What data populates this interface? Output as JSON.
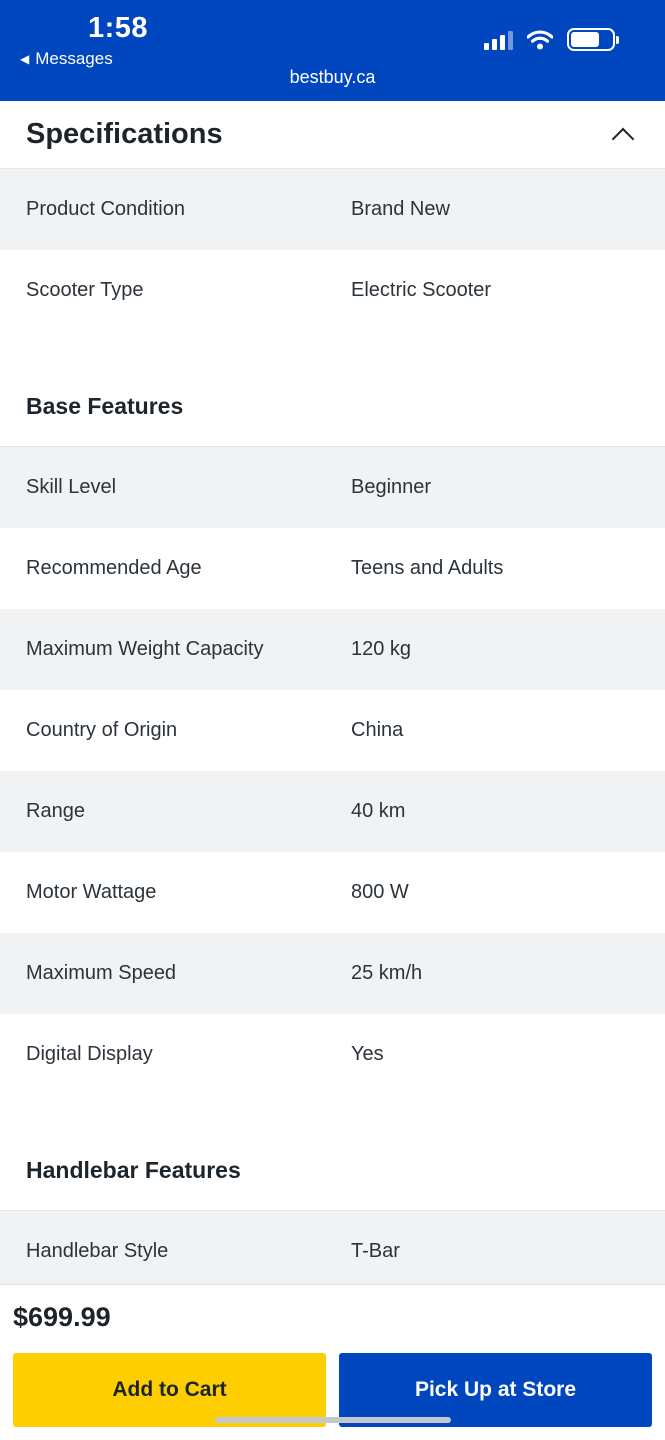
{
  "status": {
    "time": "1:58",
    "back_label": "Messages",
    "url": "bestbuy.ca"
  },
  "specifications": {
    "title": "Specifications",
    "general_rows": [
      {
        "label": "Product Condition",
        "value": "Brand New"
      },
      {
        "label": "Scooter Type",
        "value": "Electric Scooter"
      }
    ],
    "base_features": {
      "title": "Base Features",
      "rows": [
        {
          "label": "Skill Level",
          "value": "Beginner"
        },
        {
          "label": "Recommended Age",
          "value": "Teens and Adults"
        },
        {
          "label": "Maximum Weight Capacity",
          "value": "120 kg"
        },
        {
          "label": "Country of Origin",
          "value": "China"
        },
        {
          "label": "Range",
          "value": "40 km"
        },
        {
          "label": "Motor Wattage",
          "value": "800 W"
        },
        {
          "label": "Maximum Speed",
          "value": "25 km/h"
        },
        {
          "label": "Digital Display",
          "value": "Yes"
        }
      ]
    },
    "handlebar_features": {
      "title": "Handlebar Features",
      "rows": [
        {
          "label": "Handlebar Style",
          "value": "T-Bar"
        }
      ]
    }
  },
  "purchase": {
    "price": "$699.99",
    "add_to_cart_label": "Add to Cart",
    "pickup_label": "Pick Up at Store"
  },
  "colors": {
    "brand_blue": "#0046be",
    "brand_yellow": "#ffce00"
  }
}
